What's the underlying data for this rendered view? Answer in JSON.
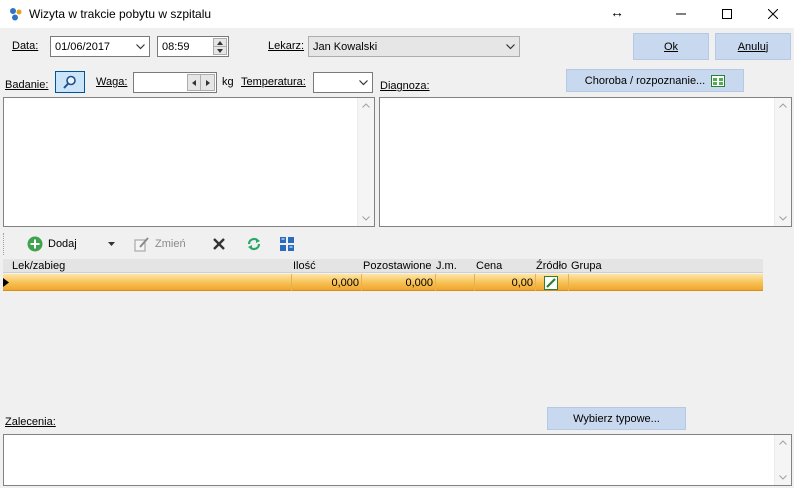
{
  "window": {
    "title": "Wizyta w trakcie pobytu w szpitalu"
  },
  "header": {
    "date_label": "Data:",
    "date_value": "01/06/2017",
    "time_value": "08:59",
    "doctor_label": "Lekarz:",
    "doctor_value": "Jan Kowalski",
    "ok_label": "Ok",
    "cancel_label": "Anuluj"
  },
  "exam": {
    "badanie_label": "Badanie:",
    "waga_label": "Waga:",
    "waga_value": "",
    "kg_label": "kg",
    "temp_label": "Temperatura:",
    "temp_value": "",
    "diagnoza_label": "Diagnoza:",
    "choroba_button": "Choroba / rozpoznanie...",
    "badanie_text": "",
    "diagnoza_text": ""
  },
  "toolbar": {
    "add_label": "Dodaj",
    "edit_label": "Zmień"
  },
  "grid": {
    "columns": [
      "Lek/zabieg",
      "Ilość",
      "Pozostawione",
      "J.m.",
      "Cena",
      "Źródło",
      "Grupa"
    ],
    "rows": [
      {
        "name": "",
        "ilosc": "0,000",
        "pozostawione": "0,000",
        "jm": "",
        "cena": "0,00",
        "grupa": ""
      }
    ]
  },
  "recommendations": {
    "label": "Zalecenia:",
    "select_button": "Wybierz typowe...",
    "text": ""
  }
}
